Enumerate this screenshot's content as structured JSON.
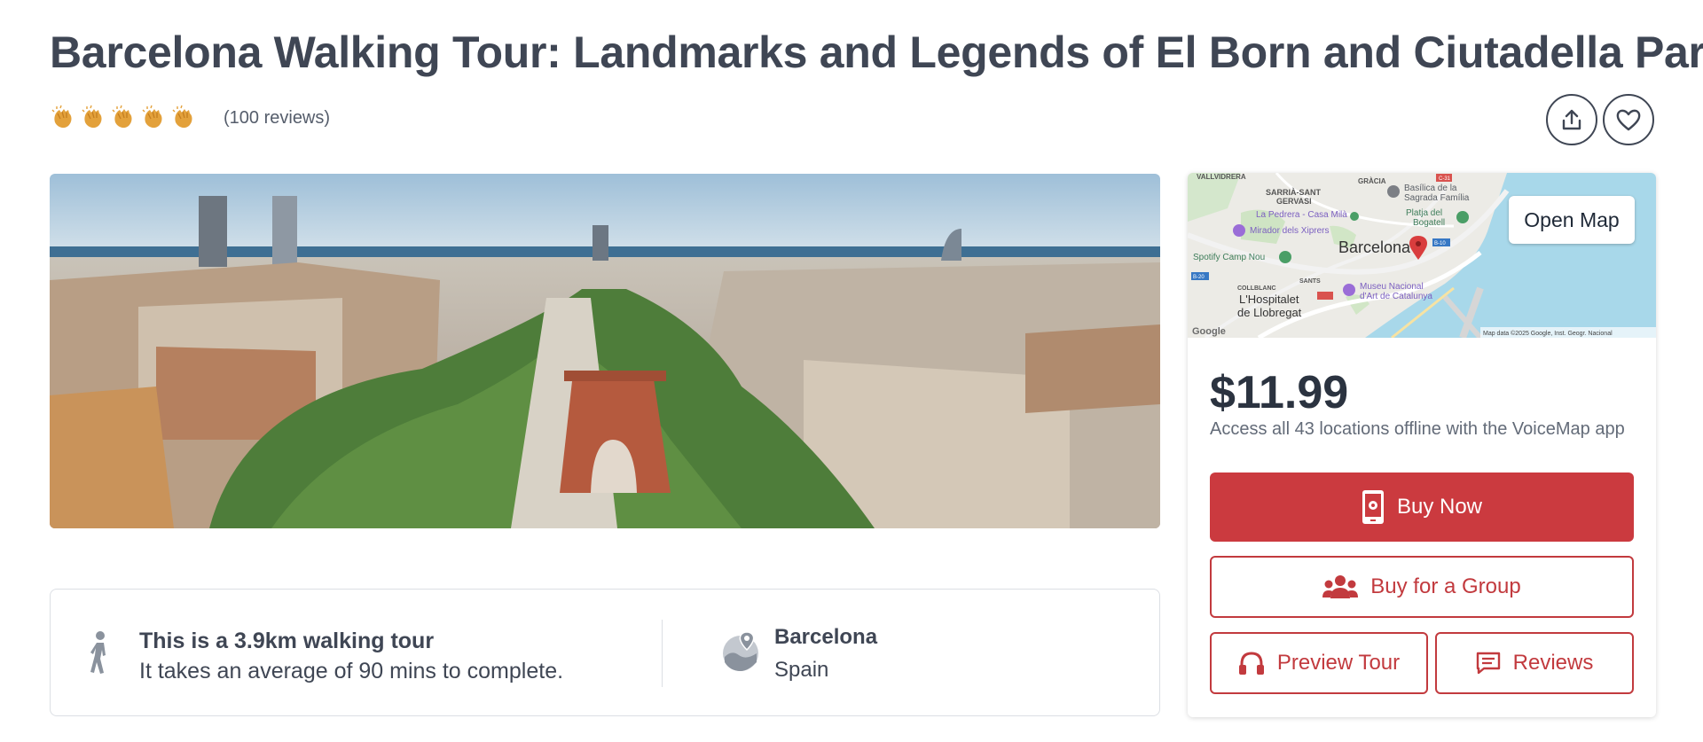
{
  "header": {
    "title": "Barcelona Walking Tour: Landmarks and Legends of El Born and Ciutadella Park",
    "reviews_label": "(100 reviews)",
    "rating_icons": 5
  },
  "tour_info": {
    "distance_title": "This is a 3.9km walking tour",
    "duration_text": "It takes an average of 90 mins to complete.",
    "city": "Barcelona",
    "country": "Spain"
  },
  "map": {
    "open_map_label": "Open Map",
    "labels": {
      "vallvidrera": "VALLVIDRERA",
      "gracia": "GRÀCIA",
      "sarria": "SARRIÀ-SANT",
      "gervasi": "GERVASI",
      "sagrada1": "Basílica de la",
      "sagrada2": "Sagrada Família",
      "pedrera": "La Pedrera - Casa Milà",
      "mirador": "Mirador dels Xiprers",
      "platja1": "Platja del",
      "platja2": "Bogatell",
      "barcelona": "Barcelona",
      "camp_nou": "Spotify Camp Nou",
      "collblanc": "COLLBLANC",
      "sants": "SANTS",
      "hospitalet1": "L'Hospitalet",
      "hospitalet2": "de Llobregat",
      "museu1": "Museu Nacional",
      "museu2": "d'Art de Catalunya",
      "google": "Google",
      "credit": "Map data ©2025 Google, Inst. Geogr. Nacional",
      "road_c31": "C-31",
      "road_b10": "B-10",
      "road_b20": "B-20"
    }
  },
  "purchase": {
    "price": "$11.99",
    "access_text": "Access all 43 locations offline with the VoiceMap app",
    "buy_now": "Buy Now",
    "buy_group": "Buy for a Group",
    "preview": "Preview Tour",
    "reviews": "Reviews"
  },
  "colors": {
    "brand_red": "#cb3a3f",
    "text_dark": "#3f4654",
    "clap_gold": "#e3a13b"
  }
}
